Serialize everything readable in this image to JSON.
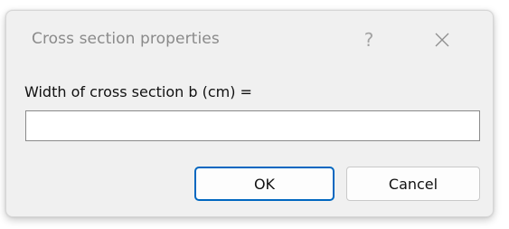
{
  "dialog": {
    "title": "Cross section properties",
    "help_glyph": "?",
    "close_icon": "close-icon",
    "prompt": "Width of cross section b (cm) =",
    "input": {
      "value": "",
      "placeholder": ""
    },
    "ok_label": "OK",
    "cancel_label": "Cancel"
  },
  "colors": {
    "dialog_bg": "#f0f0f0",
    "default_button_border": "#0067c0",
    "title_text": "#8a8a8a"
  }
}
